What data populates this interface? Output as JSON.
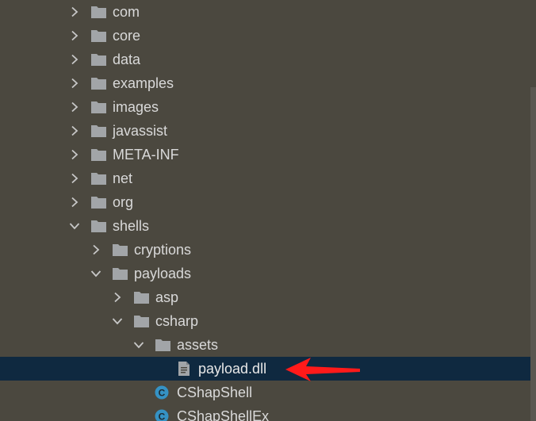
{
  "tree": {
    "items": [
      {
        "label": "com",
        "kind": "folder",
        "expanded": false,
        "depth": 0
      },
      {
        "label": "core",
        "kind": "folder",
        "expanded": false,
        "depth": 0
      },
      {
        "label": "data",
        "kind": "folder",
        "expanded": false,
        "depth": 0
      },
      {
        "label": "examples",
        "kind": "folder",
        "expanded": false,
        "depth": 0
      },
      {
        "label": "images",
        "kind": "folder",
        "expanded": false,
        "depth": 0
      },
      {
        "label": "javassist",
        "kind": "folder",
        "expanded": false,
        "depth": 0
      },
      {
        "label": "META-INF",
        "kind": "folder",
        "expanded": false,
        "depth": 0
      },
      {
        "label": "net",
        "kind": "folder",
        "expanded": false,
        "depth": 0
      },
      {
        "label": "org",
        "kind": "folder",
        "expanded": false,
        "depth": 0
      },
      {
        "label": "shells",
        "kind": "folder",
        "expanded": true,
        "depth": 0
      },
      {
        "label": "cryptions",
        "kind": "folder",
        "expanded": false,
        "depth": 1
      },
      {
        "label": "payloads",
        "kind": "folder",
        "expanded": true,
        "depth": 1
      },
      {
        "label": "asp",
        "kind": "folder",
        "expanded": false,
        "depth": 2
      },
      {
        "label": "csharp",
        "kind": "folder",
        "expanded": true,
        "depth": 2
      },
      {
        "label": "assets",
        "kind": "folder",
        "expanded": true,
        "depth": 3
      },
      {
        "label": "payload.dll",
        "kind": "file",
        "expanded": false,
        "depth": 4,
        "selected": true
      },
      {
        "label": "CShapShell",
        "kind": "class",
        "expanded": false,
        "depth": 3
      },
      {
        "label": "CShapShellEx",
        "kind": "class",
        "expanded": false,
        "depth": 3
      }
    ]
  },
  "colors": {
    "background": "#4b483f",
    "selection": "#0f2940",
    "folder_icon": "#a2a5a8",
    "text": "#d9d9d9",
    "arrow": "#c7c7c7",
    "class_icon": "#3592c4",
    "annotation_arrow": "#ff1a1a"
  },
  "icons": {
    "collapsed": "chevron-right-icon",
    "expanded": "chevron-down-icon",
    "folder": "folder-icon",
    "file": "file-icon",
    "class": "class-icon",
    "annotation": "red-arrow-icon"
  }
}
